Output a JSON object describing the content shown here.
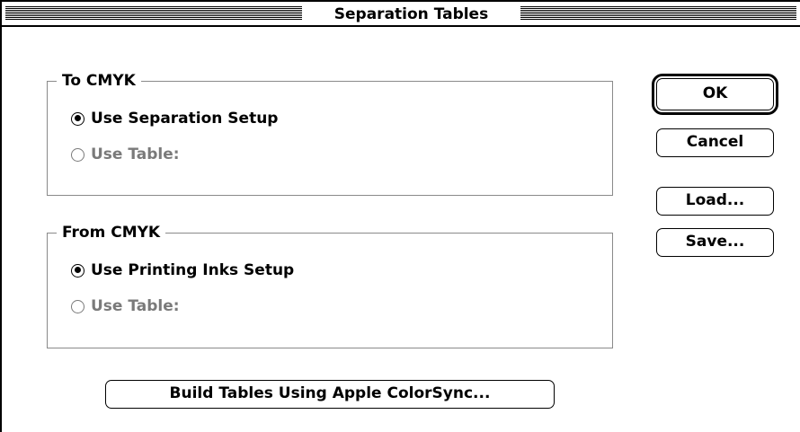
{
  "window": {
    "title": "Separation Tables"
  },
  "to_cmyk": {
    "label": "To CMYK",
    "options": [
      {
        "label": "Use Separation Setup",
        "selected": true,
        "enabled": true
      },
      {
        "label": "Use Table:",
        "selected": false,
        "enabled": false
      }
    ]
  },
  "from_cmyk": {
    "label": "From CMYK",
    "options": [
      {
        "label": "Use Printing Inks Setup",
        "selected": true,
        "enabled": true
      },
      {
        "label": "Use Table:",
        "selected": false,
        "enabled": false
      }
    ]
  },
  "buttons": {
    "ok": "OK",
    "cancel": "Cancel",
    "load": "Load...",
    "save": "Save...",
    "colorsync": "Build Tables Using Apple ColorSync..."
  },
  "colors": {
    "text": "#000000",
    "disabled_text": "#7a7a7a",
    "group_border": "#8a8a8a",
    "background": "#ffffff"
  }
}
